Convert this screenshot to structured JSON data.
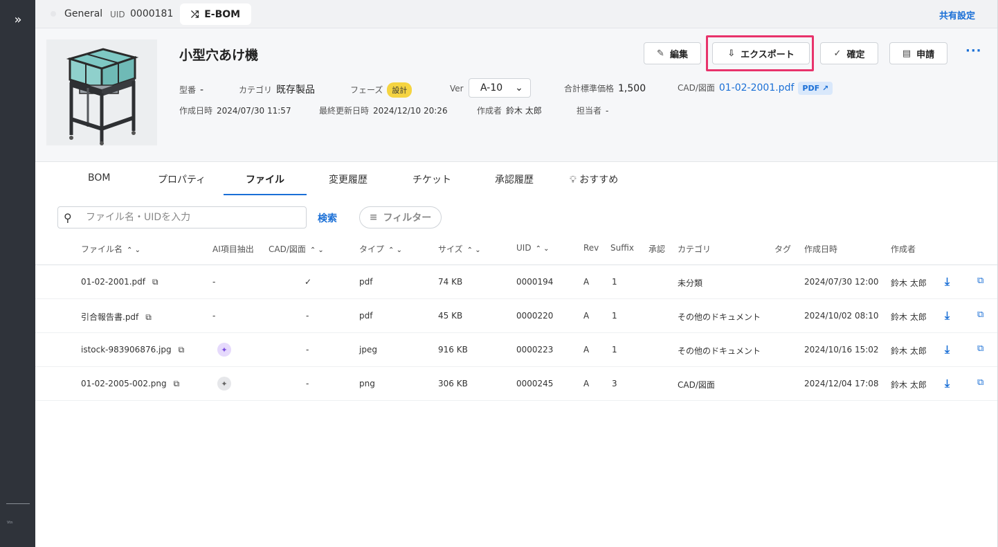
{
  "rail": {
    "expand_icon": "chevron-double-right-icon",
    "brand_text": "Vtn"
  },
  "topbar": {
    "general_label": "General",
    "uid_label": "UID",
    "uid_value": "0000181",
    "active_tab": "E-BOM",
    "share_label": "共有設定"
  },
  "header": {
    "title": "小型穴あけ機",
    "buttons": {
      "edit": "編集",
      "export": "エクスポート",
      "confirm": "確定",
      "apply": "申請"
    },
    "more": "···",
    "meta": {
      "model_label": "型番",
      "model_value": "-",
      "category_label": "カテゴリ",
      "category_value": "既存製品",
      "phase_label": "フェーズ",
      "phase_value": "設計",
      "ver_label": "Ver",
      "ver_value": "A-10",
      "price_label": "合計標準価格",
      "price_value": "1,500",
      "cad_label": "CAD/図面",
      "cad_value": "01-02-2001.pdf",
      "pdf_badge": "PDF"
    },
    "meta2": {
      "created_label": "作成日時",
      "created_value": "2024/07/30 11:57",
      "updated_label": "最終更新日時",
      "updated_value": "2024/12/10 20:26",
      "author_label": "作成者",
      "author_value": "鈴木 太郎",
      "owner_label": "担当者",
      "owner_value": "-"
    }
  },
  "tabs": [
    "BOM",
    "プロパティ",
    "ファイル",
    "変更履歴",
    "チケット",
    "承認履歴",
    "おすすめ"
  ],
  "search": {
    "placeholder": "ファイル名・UIDを入力",
    "button": "検索",
    "filter": "フィルター"
  },
  "table": {
    "headers": {
      "name": "ファイル名",
      "ai": "AI項目抽出",
      "cad": "CAD/図面",
      "type": "タイプ",
      "size": "サイズ",
      "uid": "UID",
      "rev": "Rev",
      "suffix": "Suffix",
      "approval": "承認",
      "category": "カテゴリ",
      "tag": "タグ",
      "created": "作成日時",
      "author": "作成者"
    },
    "rows": [
      {
        "name": "01-02-2001.pdf",
        "ai": "-",
        "cad": "✓",
        "type": "pdf",
        "size": "74 KB",
        "uid": "0000194",
        "rev": "A",
        "suffix": "1",
        "category": "未分類",
        "created": "2024/07/30 12:00",
        "author": "鈴木 太郎"
      },
      {
        "name": "引合報告書.pdf",
        "ai": "-",
        "cad": "-",
        "type": "pdf",
        "size": "45 KB",
        "uid": "0000220",
        "rev": "A",
        "suffix": "1",
        "category": "その他のドキュメント",
        "created": "2024/10/02 08:10",
        "author": "鈴木 太郎"
      },
      {
        "name": "istock-983906876.jpg",
        "ai": "sparkle-purple",
        "cad": "-",
        "type": "jpeg",
        "size": "916 KB",
        "uid": "0000223",
        "rev": "A",
        "suffix": "1",
        "category": "その他のドキュメント",
        "created": "2024/10/16 15:02",
        "author": "鈴木 太郎"
      },
      {
        "name": "01-02-2005-002.png",
        "ai": "sparkle-gray",
        "cad": "-",
        "type": "png",
        "size": "306 KB",
        "uid": "0000245",
        "rev": "A",
        "suffix": "3",
        "category": "CAD/図面",
        "created": "2024/12/04 17:08",
        "author": "鈴木 太郎"
      }
    ]
  },
  "colors": {
    "accent": "#1a6fd6",
    "highlight": "#e8336b",
    "rail": "#2f333a",
    "phase_badge": "#f5d441"
  }
}
